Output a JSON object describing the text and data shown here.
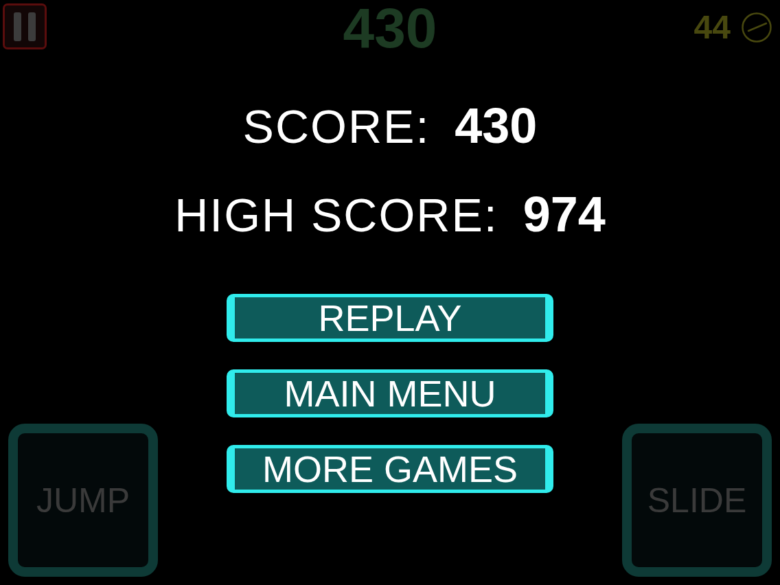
{
  "hud": {
    "score": "430",
    "time_left": "44"
  },
  "results": [
    {
      "label": "SCORE:",
      "value": "430"
    },
    {
      "label": "HIGH SCORE:",
      "value": "974"
    }
  ],
  "menu_buttons": [
    "REPLAY",
    "MAIN MENU",
    "MORE GAMES"
  ],
  "controls": [
    {
      "label": "JUMP"
    },
    {
      "label": "SLIDE"
    }
  ]
}
